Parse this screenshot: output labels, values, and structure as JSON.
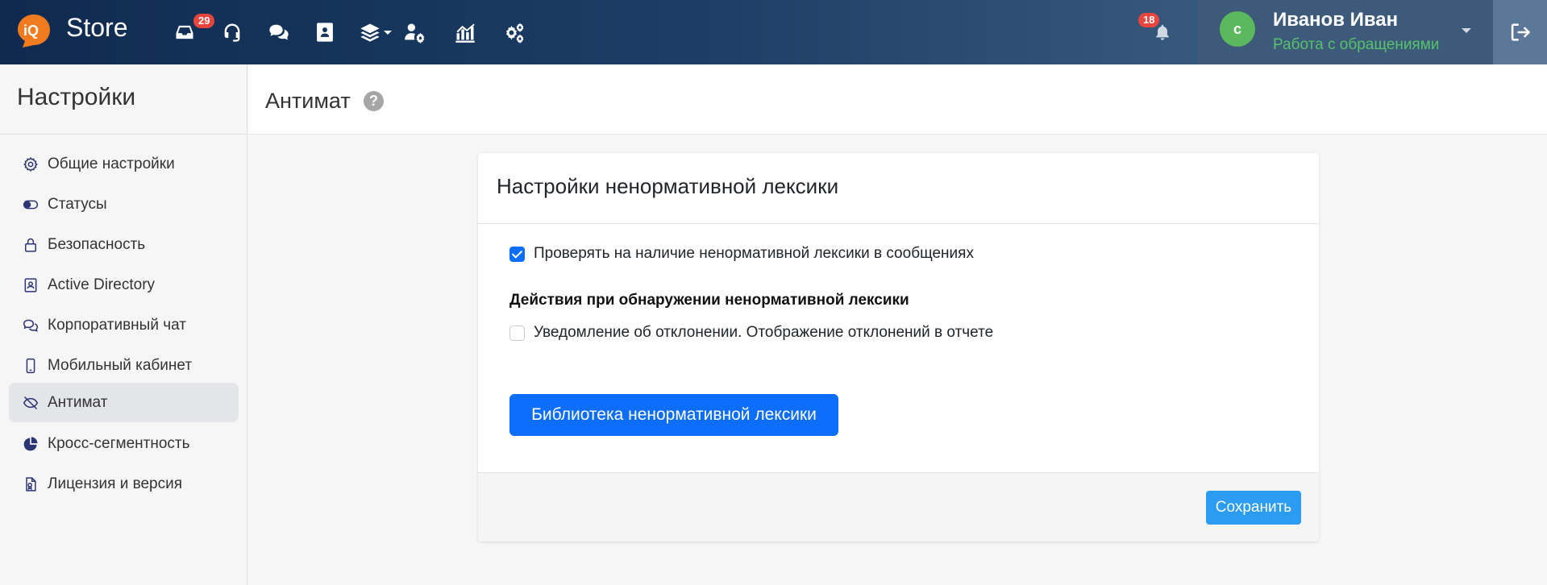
{
  "header": {
    "brand": "Store",
    "inbox_badge": "29",
    "notifications_badge": "18",
    "user_name": "Иванов Иван",
    "user_role": "Работа с обращениями",
    "avatar_initial": "с"
  },
  "sidebar": {
    "title": "Настройки",
    "items": [
      {
        "label": "Общие настройки",
        "icon": "gear-icon"
      },
      {
        "label": "Статусы",
        "icon": "toggle-icon"
      },
      {
        "label": "Безопасность",
        "icon": "lock-icon"
      },
      {
        "label": "Active Directory",
        "icon": "address-book-icon"
      },
      {
        "label": "Корпоративный чат",
        "icon": "comments-icon"
      },
      {
        "label": "Мобильный кабинет",
        "icon": "mobile-icon"
      },
      {
        "label": "Антимат",
        "icon": "eye-slash-icon",
        "active": true
      },
      {
        "label": "Кросс-сегментность",
        "icon": "pie-chart-icon"
      },
      {
        "label": "Лицензия и версия",
        "icon": "file-license-icon"
      }
    ]
  },
  "page": {
    "title": "Антимат",
    "help": "?"
  },
  "card": {
    "title": "Настройки ненормативной лексики",
    "check_profanity_label": "Проверять на наличие ненормативной лексики в сообщениях",
    "check_profanity_checked": true,
    "actions_title": "Действия при обнаружении ненормативной лексики",
    "notify_label": "Уведомление об отклонении. Отображение отклонений в отчете",
    "notify_checked": false,
    "library_button": "Библиотека ненормативной лексики",
    "save_button": "Сохранить"
  },
  "colors": {
    "primary": "#0d6efd",
    "save": "#2b9cf2",
    "badge": "#e8453c",
    "role": "#56c26b",
    "sidebar_icon": "#2b3574"
  }
}
